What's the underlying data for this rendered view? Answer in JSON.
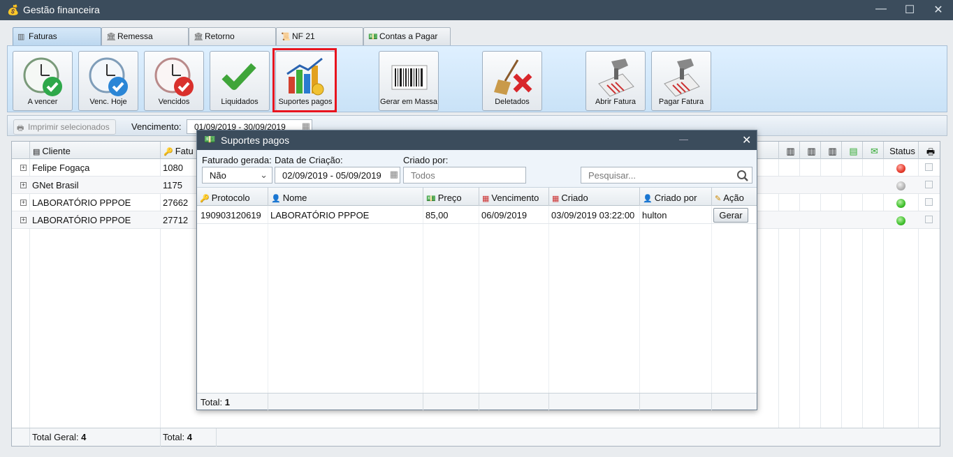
{
  "window": {
    "title": "Gestão financeira",
    "icon": "money-bag-icon"
  },
  "tabs": [
    {
      "label": "Faturas",
      "icon": "barcode-icon",
      "active": true
    },
    {
      "label": "Remessa",
      "icon": "bank-icon"
    },
    {
      "label": "Retorno",
      "icon": "bank-icon"
    },
    {
      "label": "NF 21",
      "icon": "certificate-icon"
    },
    {
      "label": "Contas a Pagar",
      "icon": "cash-icon"
    }
  ],
  "toolbar": {
    "a_vencer": "A vencer",
    "venc_hoje": "Venc. Hoje",
    "vencidos": "Vencidos",
    "liquidados": "Liquidados",
    "suportes_pagos": "Suportes pagos",
    "gerar_massa": "Gerar em Massa",
    "deletados": "Deletados",
    "abrir_fatura": "Abrir Fatura",
    "pagar_fatura": "Pagar Fatura"
  },
  "subbar": {
    "print_selected": "Imprimir selecionados",
    "vencimento_label": "Vencimento:",
    "vencimento_range": "01/09/2019 - 30/09/2019"
  },
  "grid": {
    "columns": {
      "cliente": "Cliente",
      "fatura": "Fatu",
      "status": "Status"
    },
    "rows": [
      {
        "cliente": "Felipe Fogaça",
        "fatura": "1080",
        "status": "red"
      },
      {
        "cliente": "GNet Brasil",
        "fatura": "1175",
        "status": "gray"
      },
      {
        "cliente": "LABORATÓRIO PPPOE",
        "fatura": "27662",
        "status": "green"
      },
      {
        "cliente": "LABORATÓRIO PPPOE",
        "fatura": "27712",
        "status": "green"
      }
    ],
    "footer": {
      "total_geral_label": "Total Geral:",
      "total_geral_value": "4",
      "total_label": "Total:",
      "total_value": "4"
    }
  },
  "modal": {
    "title": "Suportes pagos",
    "filters": {
      "faturado_label": "Faturado gerada:",
      "faturado_value": "Não",
      "data_label": "Data de Criação:",
      "data_value": "02/09/2019 - 05/09/2019",
      "criado_label": "Criado por:",
      "criado_placeholder": "Todos",
      "search_placeholder": "Pesquisar..."
    },
    "columns": {
      "protocolo": "Protocolo",
      "nome": "Nome",
      "preco": "Preço",
      "vencimento": "Vencimento",
      "criado": "Criado",
      "criado_por": "Criado por",
      "acao": "Ação"
    },
    "rows": [
      {
        "protocolo": "190903120619",
        "nome": "LABORATÓRIO PPPOE",
        "preco": "85,00",
        "vencimento": "06/09/2019",
        "criado": "03/09/2019 03:22:00",
        "criado_por": "hulton",
        "acao": "Gerar"
      }
    ],
    "footer": {
      "total_label": "Total:",
      "total_value": "1"
    }
  }
}
